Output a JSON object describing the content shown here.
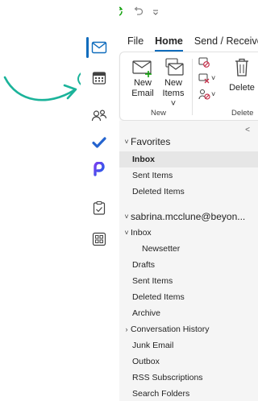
{
  "quick_access": {
    "icons": [
      "outlook-app-icon",
      "sync-icon",
      "undo-icon",
      "customize-icon"
    ]
  },
  "ribbon": {
    "tabs": [
      {
        "label": "File",
        "active": false
      },
      {
        "label": "Home",
        "active": true
      },
      {
        "label": "Send / Receive",
        "active": false
      }
    ],
    "new_group": {
      "new_email_line1": "New",
      "new_email_line2": "Email",
      "new_items_line1": "New",
      "new_items_line2": "Items ˅",
      "label": "New"
    },
    "delete_group": {
      "delete_label": "Delete",
      "label": "Delete"
    }
  },
  "rail": {
    "items": [
      "mail-icon",
      "calendar-icon",
      "people-icon",
      "todo-icon",
      "loop-icon",
      "clipboard-icon",
      "apps-icon"
    ],
    "accent": "#0f6cbd"
  },
  "annotation_color": "#1bb39a",
  "folder_pane": {
    "favorites": {
      "label": "Favorites",
      "items": [
        "Inbox",
        "Sent Items",
        "Deleted Items"
      ],
      "selected": "Inbox"
    },
    "account": {
      "label": "sabrina.mcclune@beyon...",
      "inbox_label": "Inbox",
      "inbox_children": [
        "Newsetter"
      ],
      "items": [
        "Drafts",
        "Sent Items",
        "Deleted Items",
        "Archive"
      ],
      "conversation_history": "Conversation History",
      "items_after": [
        "Junk Email",
        "Outbox",
        "RSS Subscriptions",
        "Search Folders"
      ]
    }
  }
}
